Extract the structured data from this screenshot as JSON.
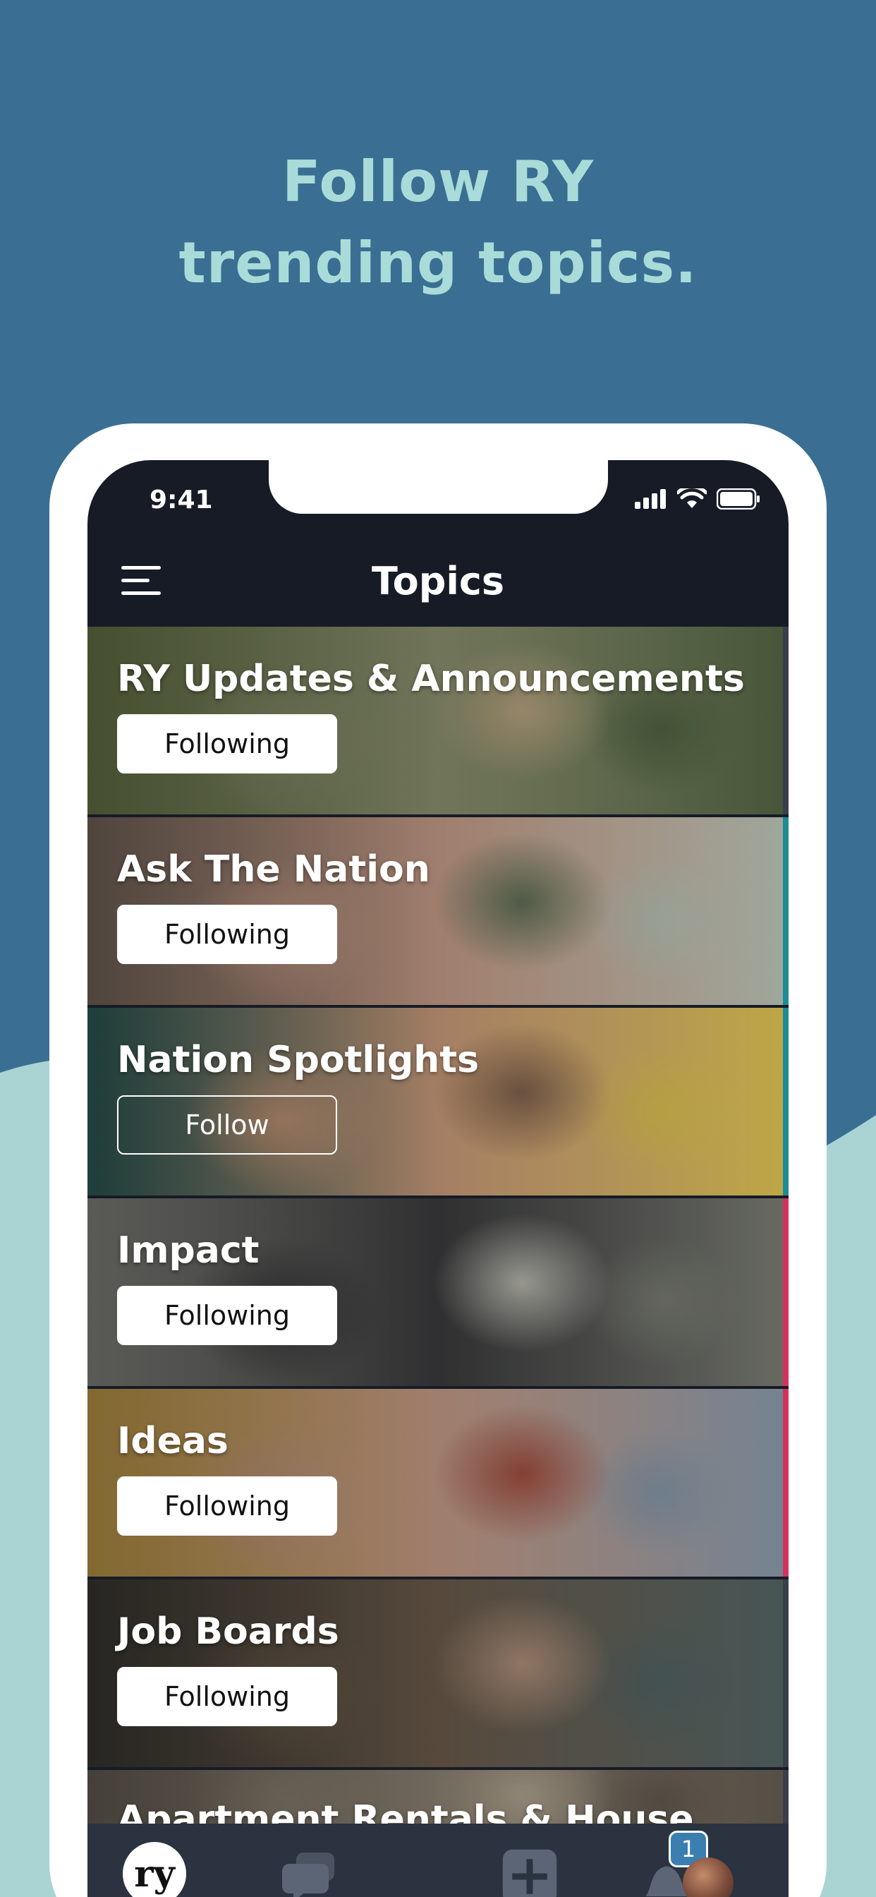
{
  "page": {
    "headline_line1": "Follow RY",
    "headline_line2": "trending topics."
  },
  "status_bar": {
    "time": "9:41"
  },
  "navbar": {
    "title": "Topics"
  },
  "topics": [
    {
      "title": "RY Updates & Announcements",
      "button": "Following",
      "state": "following",
      "accent": "#3a3f4a"
    },
    {
      "title": "Ask The Nation",
      "button": "Following",
      "state": "following",
      "accent": "#1e8c96"
    },
    {
      "title": "Nation Spotlights",
      "button": "Follow",
      "state": "follow",
      "accent": "#1e8c96"
    },
    {
      "title": "Impact",
      "button": "Following",
      "state": "following",
      "accent": "#d4325c"
    },
    {
      "title": "Ideas",
      "button": "Following",
      "state": "following",
      "accent": "#d4325c"
    },
    {
      "title": "Job Boards",
      "button": "Following",
      "state": "following",
      "accent": "#3a3f4a"
    },
    {
      "title": "Apartment Rentals & House",
      "button": "",
      "state": "partial",
      "accent": "#3a3f4a"
    }
  ],
  "tabbar": {
    "logo_text": "ry",
    "notification_count": "1",
    "icons": [
      "ry-logo-icon",
      "chat-icon",
      "add-post-icon",
      "bell-icon",
      "profile-avatar"
    ]
  },
  "colors": {
    "background_top": "#3a6f93",
    "background_bottom": "#a9d4d3",
    "headline": "#a9dcd9",
    "screen_dark": "#161b26",
    "tabbar": "#2b3240"
  }
}
